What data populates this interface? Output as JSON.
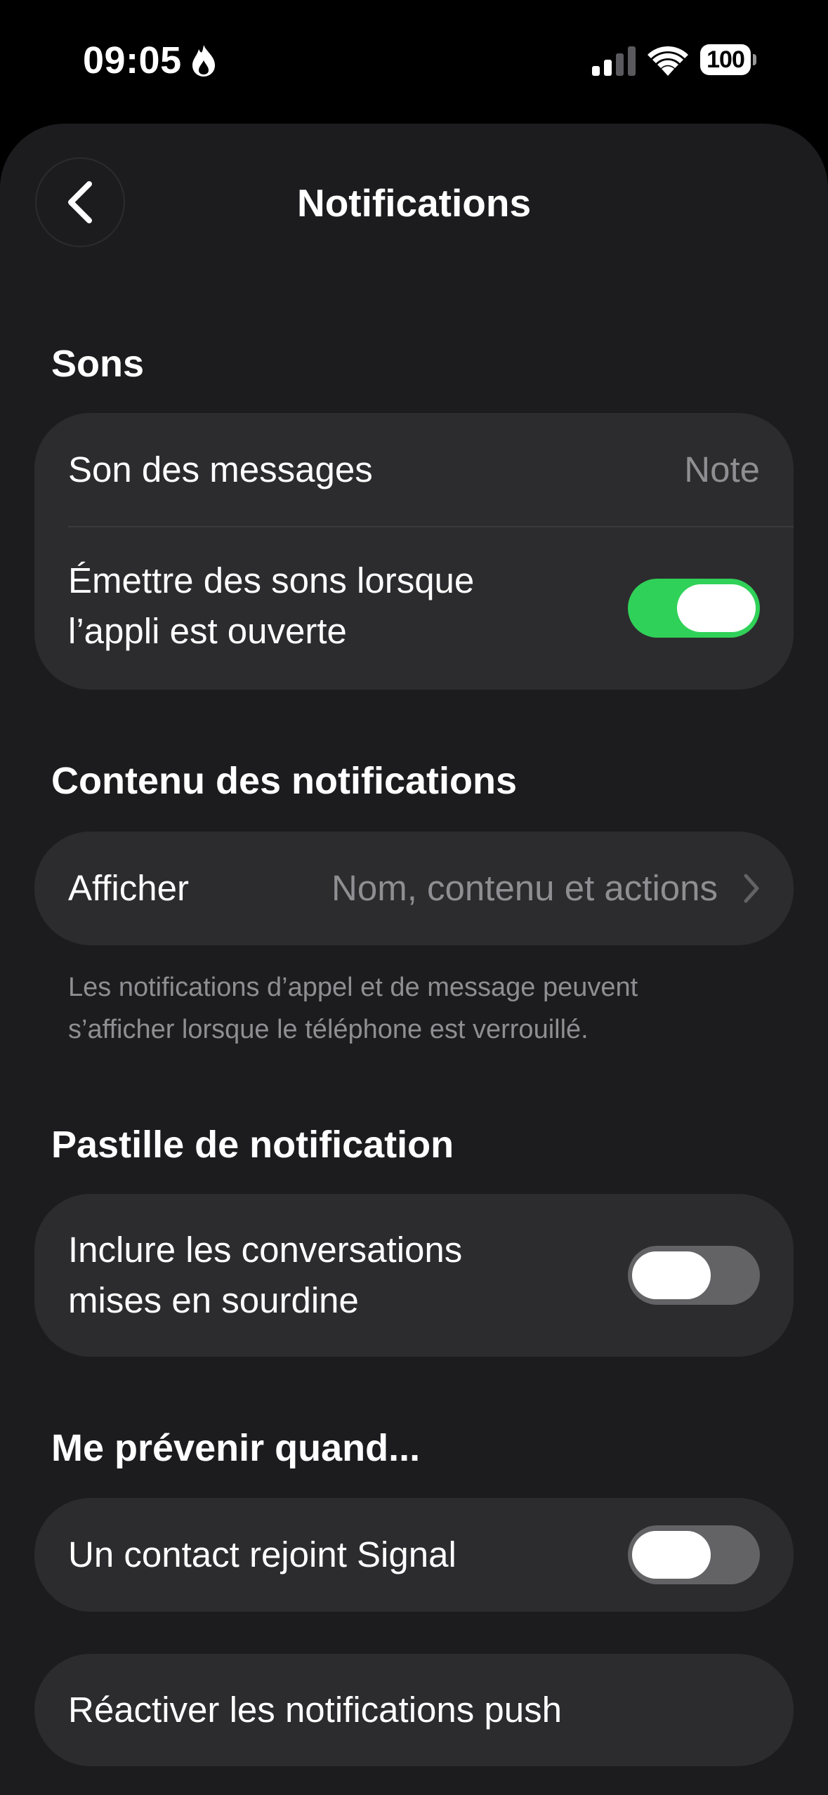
{
  "status_bar": {
    "time": "09:05",
    "battery": "100"
  },
  "header": {
    "title": "Notifications"
  },
  "sections": {
    "sounds": {
      "title": "Sons",
      "message_sound_label": "Son des messages",
      "message_sound_value": "Note",
      "in_app_sounds_label_line1": "Émettre des sons lorsque",
      "in_app_sounds_label_line2": "l’appli est ouverte",
      "in_app_sounds_on": true
    },
    "content": {
      "title": "Contenu des notifications",
      "show_label": "Afficher",
      "show_value": "Nom, contenu et actions",
      "footnote_line1": "Les notifications d’appel et de message peuvent",
      "footnote_line2": "s’afficher lorsque le téléphone est verrouillé."
    },
    "badge": {
      "title": "Pastille de notification",
      "include_muted_label_line1": "Inclure les conversations",
      "include_muted_label_line2": "mises en sourdine",
      "include_muted_on": false
    },
    "notify_when": {
      "title": "Me prévenir quand...",
      "contact_joins_label": "Un contact rejoint Signal",
      "contact_joins_on": false
    },
    "push": {
      "reenable_label": "Réactiver les notifications push"
    }
  },
  "colors": {
    "background": "#000000",
    "sheet": "#1c1c1e",
    "card": "#2c2c2e",
    "toggle_on": "#30d158",
    "toggle_off": "#636366",
    "secondary_text": "#8e8e93"
  },
  "icons": {
    "flame": "flame-icon",
    "signal": "cellular-signal-icon",
    "wifi": "wifi-icon",
    "back": "chevron-left-icon",
    "disclosure": "chevron-right-icon"
  }
}
